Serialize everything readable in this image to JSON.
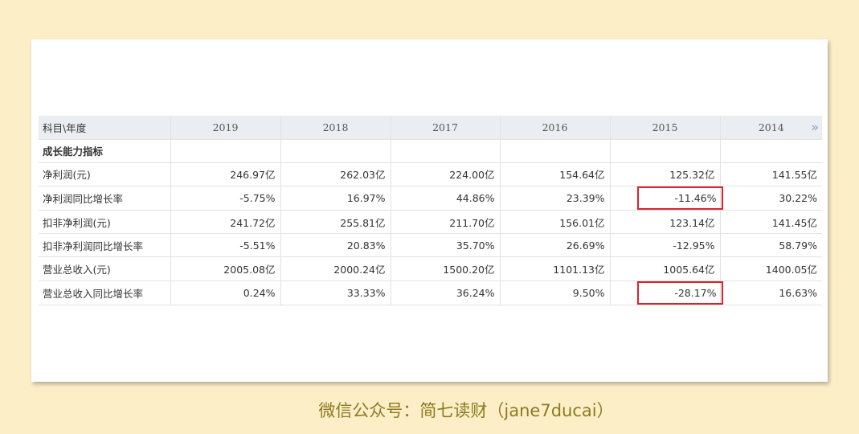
{
  "table": {
    "header_label": "科目\\年度",
    "years": [
      "2019",
      "2018",
      "2017",
      "2016",
      "2015",
      "2014"
    ],
    "more_icon": "»",
    "rows": [
      {
        "label": "成长能力指标",
        "values": [
          "",
          "",
          "",
          "",
          "",
          ""
        ],
        "section": true
      },
      {
        "label": "净利润(元)",
        "values": [
          "246.97亿",
          "262.03亿",
          "224.00亿",
          "154.64亿",
          "125.32亿",
          "141.55亿"
        ]
      },
      {
        "label": "净利润同比增长率",
        "values": [
          "-5.75%",
          "16.97%",
          "44.86%",
          "23.39%",
          "-11.46%",
          "30.22%"
        ],
        "highlight_col": 4
      },
      {
        "label": "扣非净利润(元)",
        "values": [
          "241.72亿",
          "255.81亿",
          "211.70亿",
          "156.01亿",
          "123.14亿",
          "141.45亿"
        ]
      },
      {
        "label": "扣非净利润同比增长率",
        "values": [
          "-5.51%",
          "20.83%",
          "35.70%",
          "26.69%",
          "-12.95%",
          "58.79%"
        ]
      },
      {
        "label": "营业总收入(元)",
        "values": [
          "2005.08亿",
          "2000.24亿",
          "1500.20亿",
          "1101.13亿",
          "1005.64亿",
          "1400.05亿"
        ]
      },
      {
        "label": "营业总收入同比增长率",
        "values": [
          "0.24%",
          "33.33%",
          "36.24%",
          "9.50%",
          "-28.17%",
          "16.63%"
        ],
        "highlight_col": 4
      }
    ]
  },
  "caption": "微信公众号：简七读财（jane7ducai）",
  "colors": {
    "background": "#fcefc8",
    "header_bg": "#eaedf2",
    "highlight_border": "#d8232a",
    "caption": "#8c7a1e"
  }
}
